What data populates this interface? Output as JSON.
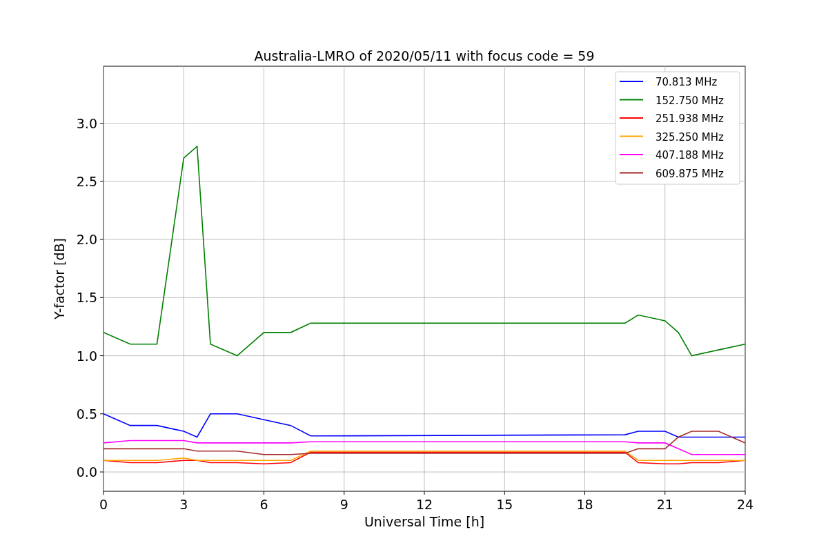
{
  "chart": {
    "chart_data": {
      "type": "line",
      "title": "Australia-LMRO of 2020/05/11 with focus code = 59",
      "xlabel": "Universal Time [h]",
      "ylabel": "Y-factor [dB]",
      "x": [
        0,
        1,
        2,
        3,
        3.5,
        4,
        5,
        6,
        7,
        7.75,
        19.5,
        20,
        21,
        21.5,
        22,
        23,
        24
      ],
      "series": [
        {
          "name": "70.813 MHz",
          "color": "#0000ff",
          "values": [
            0.5,
            0.4,
            0.4,
            0.35,
            0.3,
            0.5,
            0.5,
            0.45,
            0.4,
            0.31,
            0.32,
            0.35,
            0.35,
            0.3,
            0.3,
            0.3,
            0.3
          ]
        },
        {
          "name": "152.750 MHz",
          "color": "#008000",
          "values": [
            1.2,
            1.1,
            1.1,
            2.7,
            2.8,
            1.1,
            1.0,
            1.2,
            1.2,
            1.28,
            1.28,
            1.35,
            1.3,
            1.2,
            1.0,
            1.05,
            1.1
          ]
        },
        {
          "name": "251.938 MHz",
          "color": "#ff0000",
          "values": [
            0.1,
            0.08,
            0.08,
            0.1,
            0.1,
            0.08,
            0.08,
            0.07,
            0.08,
            0.17,
            0.17,
            0.08,
            0.07,
            0.07,
            0.08,
            0.08,
            0.1
          ]
        },
        {
          "name": "325.250 MHz",
          "color": "#ffa500",
          "values": [
            0.1,
            0.1,
            0.1,
            0.12,
            0.1,
            0.1,
            0.1,
            0.1,
            0.1,
            0.18,
            0.18,
            0.1,
            0.1,
            0.1,
            0.1,
            0.1,
            0.1
          ]
        },
        {
          "name": "407.188 MHz",
          "color": "#ff00ff",
          "values": [
            0.25,
            0.27,
            0.27,
            0.27,
            0.25,
            0.25,
            0.25,
            0.25,
            0.25,
            0.26,
            0.26,
            0.25,
            0.25,
            0.2,
            0.15,
            0.15,
            0.15
          ]
        },
        {
          "name": "609.875 MHz",
          "color": "#a52a2a",
          "values": [
            0.2,
            0.2,
            0.2,
            0.2,
            0.18,
            0.18,
            0.18,
            0.15,
            0.15,
            0.16,
            0.16,
            0.2,
            0.2,
            0.3,
            0.35,
            0.35,
            0.25
          ]
        }
      ],
      "grid": true,
      "legend": true,
      "xlim": [
        0,
        24
      ],
      "ylim": [
        -0.166,
        3.49
      ],
      "xticks": [
        0,
        3,
        6,
        9,
        12,
        15,
        18,
        21,
        24
      ],
      "yticks": [
        {
          "value": 0,
          "label": "0.0"
        },
        {
          "value": 0.5,
          "label": "0.5"
        },
        {
          "value": 1,
          "label": "1.0"
        },
        {
          "value": 1.5,
          "label": "1.5"
        },
        {
          "value": 2,
          "label": "2.0"
        },
        {
          "value": 2.5,
          "label": "2.5"
        },
        {
          "value": 3,
          "label": "3.0"
        }
      ]
    }
  }
}
